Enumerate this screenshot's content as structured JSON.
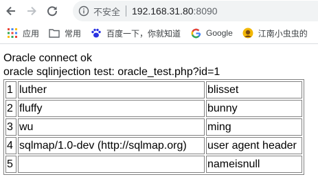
{
  "browser": {
    "security_label": "不安全",
    "url_host": "192.168.31.80",
    "url_port": ":8090"
  },
  "bookmarks": [
    {
      "label": "应用",
      "icon": "apps-grid-icon"
    },
    {
      "label": "常用",
      "icon": "folder-icon"
    },
    {
      "label": "百度一下，你就知道",
      "icon": "baidu-paw-icon"
    },
    {
      "label": "Google",
      "icon": "google-g-icon"
    },
    {
      "label": "江南小虫虫的",
      "icon": "avatar-icon"
    }
  ],
  "page": {
    "status_line": "Oracle connect ok",
    "test_line": "oracle sqlinjection test: oracle_test.php?id=1"
  },
  "table": {
    "rows": [
      {
        "id": "1",
        "first": "luther",
        "last": "blisset"
      },
      {
        "id": "2",
        "first": "fluffy",
        "last": "bunny"
      },
      {
        "id": "3",
        "first": "wu",
        "last": "ming"
      },
      {
        "id": "4",
        "first": "sqlmap/1.0-dev (http://sqlmap.org)",
        "last": "user agent header"
      },
      {
        "id": "5",
        "first": "",
        "last": "nameisnull"
      }
    ]
  },
  "colors": {
    "google_blue": "#4285f4",
    "google_red": "#ea4335",
    "google_yellow": "#fbbc05",
    "google_green": "#34a853",
    "baidu_blue": "#2932e1"
  }
}
